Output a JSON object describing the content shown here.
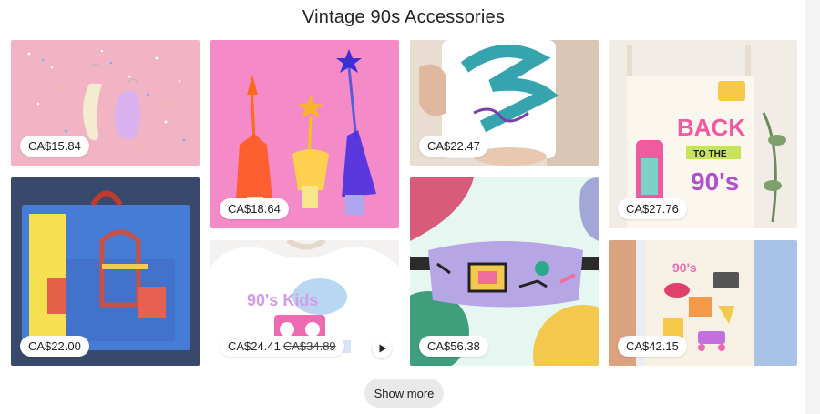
{
  "section": {
    "title": "Vintage 90s Accessories",
    "show_more_label": "Show more"
  },
  "listings": [
    {
      "name": "banana-earrings",
      "price": "CA$15.84"
    },
    {
      "name": "wine-stoppers",
      "price": "CA$18.64"
    },
    {
      "name": "jazz-cup-mug",
      "price": "CA$22.47"
    },
    {
      "name": "back-to-the-90s-tote",
      "price": "CA$27.76"
    },
    {
      "name": "vintage-backpack",
      "price": "CA$22.00"
    },
    {
      "name": "90s-tshirt",
      "price": "CA$24.41",
      "original_price": "CA$34.89",
      "has_video": true
    },
    {
      "name": "memphis-fanny-pack",
      "price": "CA$56.38"
    },
    {
      "name": "90s-sticker-tote",
      "price": "CA$42.15"
    }
  ],
  "colors": {
    "price_tag_bg": "#ffffff",
    "button_bg": "#e9e9e9"
  },
  "icons": {
    "play": "play-icon"
  }
}
